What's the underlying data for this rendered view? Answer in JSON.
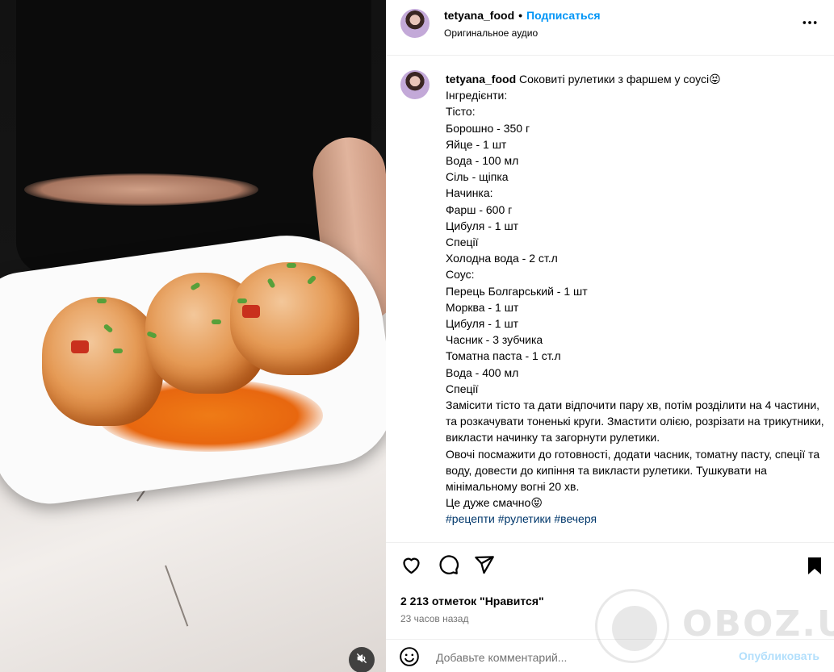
{
  "header": {
    "username": "tetyana_food",
    "separator": "•",
    "follow_label": "Подписаться",
    "audio_label": "Оригинальное аудио",
    "more_icon": "more-horizontal-icon"
  },
  "caption": {
    "username": "tetyana_food",
    "first_line": "Соковиті рулетики з фаршем у соусі😝",
    "lines": [
      "Інгредієнти:",
      "Тісто:",
      "Борошно - 350 г",
      "Яйце - 1 шт",
      "Вода - 100 мл",
      "Сіль - щіпка",
      "Начинка:",
      "Фарш - 600 г",
      "Цибуля - 1 шт",
      "Спеції",
      "Холодна вода - 2 ст.л",
      "Соус:",
      "Перець Болгарський - 1 шт",
      "Морква - 1 шт",
      "Цибуля - 1 шт",
      "Часник - 3 зубчика",
      "Томатна паста - 1 ст.л",
      "Вода - 400 мл",
      "Спеції",
      "Замісити тісто та дати відпочити пару хв, потім розділити на 4 частини, та розкачувати тоненькі круги. Змастити олією, розрізати на трикутники, викласти начинку та загорнути рулетики.",
      "Овочі посмажити до готовності, додати часник, томатну пасту, спеції та воду, довести до кипіння та викласти рулетики. Тушкувати на мінімальному вогні 20 хв.",
      "Це дуже смачно😝"
    ],
    "hashtags": "#рецепти #рулетики #вечеря"
  },
  "actions": {
    "like_icon": "heart-icon",
    "comment_icon": "comment-bubble-icon",
    "share_icon": "paper-plane-icon",
    "save_icon": "bookmark-icon",
    "likes_text": "2 213 отметок \"Нравится\"",
    "time_text": "23 часов назад"
  },
  "comment_bar": {
    "emoji_icon": "smiley-icon",
    "placeholder": "Добавьте комментарий...",
    "post_label": "Опубликовать"
  },
  "media": {
    "mute_icon": "speaker-muted-icon"
  },
  "watermark": {
    "text": "OBOZ.UA"
  }
}
